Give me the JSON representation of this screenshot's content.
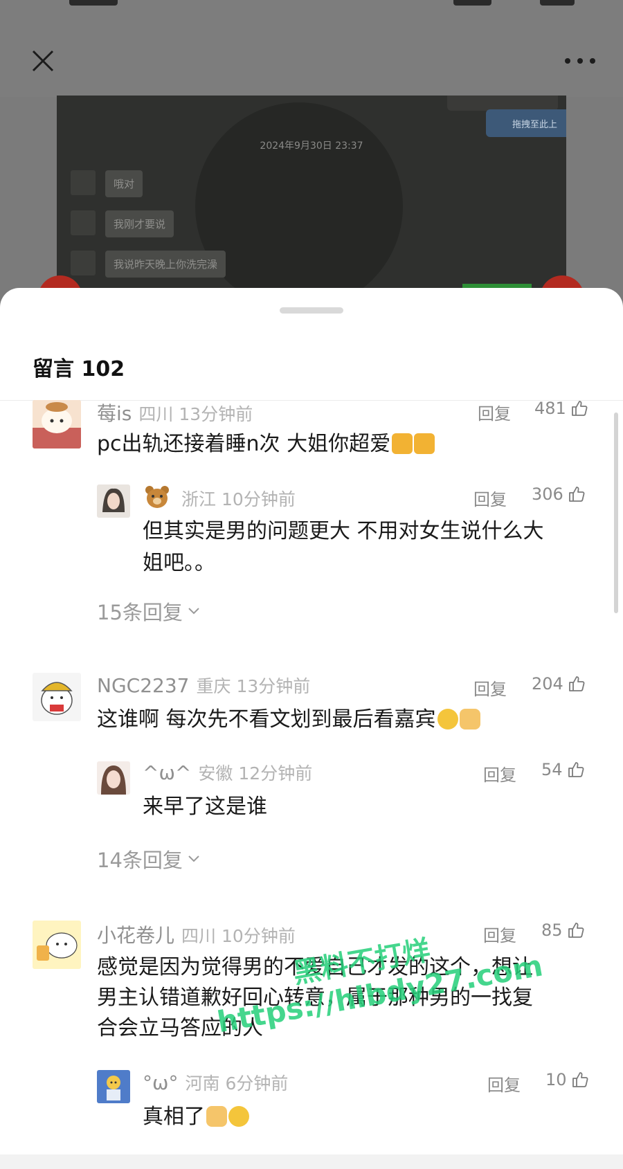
{
  "header": {},
  "media": {
    "timestamp": "2024年9月30日 23:37",
    "tag_label": "拖拽至此上",
    "messages": [
      "哦对",
      "我刚才要说",
      "我说昨天晚上你洗完澡"
    ]
  },
  "sheet": {
    "title": "留言 102"
  },
  "comments": [
    {
      "user": "莓is",
      "location": "四川",
      "time": "13分钟前",
      "reply_label": "回复",
      "likes": "481",
      "text": "pc出轨还接着睡n次 大姐你超爱",
      "reply": {
        "user": "",
        "location": "浙江",
        "time": "10分钟前",
        "reply_label": "回复",
        "likes": "306",
        "text_line1": "但其实是男的问题更大 不用对女生说什么大",
        "text_line2": "姐吧。。"
      },
      "more": "15条回复"
    },
    {
      "user": "NGC2237",
      "location": "重庆",
      "time": "13分钟前",
      "reply_label": "回复",
      "likes": "204",
      "text": "这谁啊 每次先不看文划到最后看嘉宾",
      "reply": {
        "user": "^ω^",
        "location": "安徽",
        "time": "12分钟前",
        "reply_label": "回复",
        "likes": "54",
        "text_line1": "来早了这是谁"
      },
      "more": "14条回复"
    },
    {
      "user": "小花卷儿",
      "location": "四川",
      "time": "10分钟前",
      "reply_label": "回复",
      "likes": "85",
      "text_line1": "感觉是因为觉得男的不爱自己才发的这个，想让",
      "text_line2": "男主认错道歉好回心转意，属于那种男的一找复",
      "text_line3": "合会立马答应的人",
      "reply": {
        "user": "°ω°",
        "location": "河南",
        "time": "6分钟前",
        "reply_label": "回复",
        "likes": "10",
        "text_line1": "真相了"
      }
    }
  ],
  "watermark": {
    "line1": "黑料不打烊",
    "line2": "https://hlbdy27.com"
  },
  "colors": {
    "sheet_bg": "#ffffff",
    "meta_gray": "#b3b3b3",
    "text": "#1a1a1a",
    "watermark_green": "#25d07a"
  }
}
